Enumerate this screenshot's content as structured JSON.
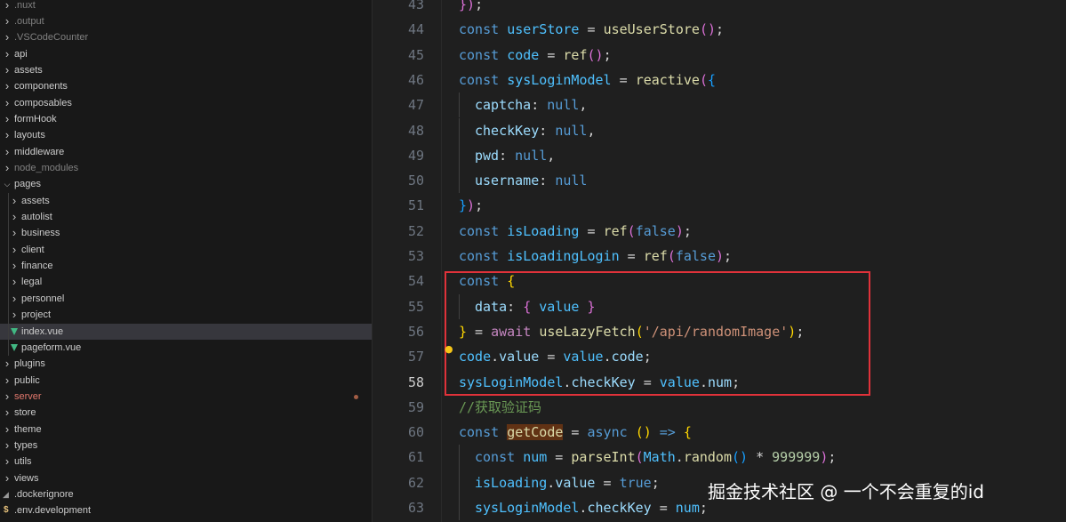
{
  "explorer": {
    "items": [
      {
        "label": ".nuxt",
        "depth": 0,
        "kind": "folder",
        "expanded": false,
        "dim": true
      },
      {
        "label": ".output",
        "depth": 0,
        "kind": "folder",
        "expanded": false,
        "dim": true
      },
      {
        "label": ".VSCodeCounter",
        "depth": 0,
        "kind": "folder",
        "expanded": false,
        "dim": true
      },
      {
        "label": "api",
        "depth": 0,
        "kind": "folder",
        "expanded": false
      },
      {
        "label": "assets",
        "depth": 0,
        "kind": "folder",
        "expanded": false
      },
      {
        "label": "components",
        "depth": 0,
        "kind": "folder",
        "expanded": false
      },
      {
        "label": "composables",
        "depth": 0,
        "kind": "folder",
        "expanded": false
      },
      {
        "label": "formHook",
        "depth": 0,
        "kind": "folder",
        "expanded": false
      },
      {
        "label": "layouts",
        "depth": 0,
        "kind": "folder",
        "expanded": false
      },
      {
        "label": "middleware",
        "depth": 0,
        "kind": "folder",
        "expanded": false
      },
      {
        "label": "node_modules",
        "depth": 0,
        "kind": "folder",
        "expanded": false,
        "dim": true
      },
      {
        "label": "pages",
        "depth": 0,
        "kind": "folder",
        "expanded": true
      },
      {
        "label": "assets",
        "depth": 1,
        "kind": "folder",
        "expanded": false
      },
      {
        "label": "autolist",
        "depth": 1,
        "kind": "folder",
        "expanded": false
      },
      {
        "label": "business",
        "depth": 1,
        "kind": "folder",
        "expanded": false
      },
      {
        "label": "client",
        "depth": 1,
        "kind": "folder",
        "expanded": false
      },
      {
        "label": "finance",
        "depth": 1,
        "kind": "folder",
        "expanded": false
      },
      {
        "label": "legal",
        "depth": 1,
        "kind": "folder",
        "expanded": false
      },
      {
        "label": "personnel",
        "depth": 1,
        "kind": "folder",
        "expanded": false
      },
      {
        "label": "project",
        "depth": 1,
        "kind": "folder",
        "expanded": false
      },
      {
        "label": "index.vue",
        "depth": 1,
        "kind": "vue",
        "selected": true
      },
      {
        "label": "pageform.vue",
        "depth": 1,
        "kind": "vue"
      },
      {
        "label": "plugins",
        "depth": 0,
        "kind": "folder",
        "expanded": false
      },
      {
        "label": "public",
        "depth": 0,
        "kind": "folder",
        "expanded": false
      },
      {
        "label": "server",
        "depth": 0,
        "kind": "folder",
        "expanded": false,
        "modified": true
      },
      {
        "label": "store",
        "depth": 0,
        "kind": "folder",
        "expanded": false
      },
      {
        "label": "theme",
        "depth": 0,
        "kind": "folder",
        "expanded": false
      },
      {
        "label": "types",
        "depth": 0,
        "kind": "folder",
        "expanded": false
      },
      {
        "label": "utils",
        "depth": 0,
        "kind": "folder",
        "expanded": false
      },
      {
        "label": "views",
        "depth": 0,
        "kind": "folder",
        "expanded": false
      },
      {
        "label": ".dockerignore",
        "depth": 0,
        "kind": "docker"
      },
      {
        "label": ".env.development",
        "depth": 0,
        "kind": "env"
      }
    ]
  },
  "editor": {
    "active_line": 58,
    "lines": [
      {
        "n": 43,
        "indent": 0,
        "tokens": [
          [
            "b2",
            "})"
          ],
          [
            "op",
            ";"
          ]
        ]
      },
      {
        "n": 44,
        "indent": 0,
        "tokens": [
          [
            "kw",
            "const"
          ],
          [
            "op",
            " "
          ],
          [
            "var",
            "userStore"
          ],
          [
            "op",
            " = "
          ],
          [
            "fn",
            "useUserStore"
          ],
          [
            "b2",
            "()"
          ],
          [
            "op",
            ";"
          ]
        ]
      },
      {
        "n": 45,
        "indent": 0,
        "tokens": [
          [
            "kw",
            "const"
          ],
          [
            "op",
            " "
          ],
          [
            "var",
            "code"
          ],
          [
            "op",
            " = "
          ],
          [
            "fn",
            "ref"
          ],
          [
            "b2",
            "()"
          ],
          [
            "op",
            ";"
          ]
        ]
      },
      {
        "n": 46,
        "indent": 0,
        "tokens": [
          [
            "kw",
            "const"
          ],
          [
            "op",
            " "
          ],
          [
            "var",
            "sysLoginModel"
          ],
          [
            "op",
            " = "
          ],
          [
            "fn",
            "reactive"
          ],
          [
            "b2",
            "("
          ],
          [
            "b3",
            "{"
          ]
        ]
      },
      {
        "n": 47,
        "indent": 1,
        "tokens": [
          [
            "prop",
            "captcha"
          ],
          [
            "op",
            ": "
          ],
          [
            "kw",
            "null"
          ],
          [
            "op",
            ","
          ]
        ]
      },
      {
        "n": 48,
        "indent": 1,
        "tokens": [
          [
            "prop",
            "checkKey"
          ],
          [
            "op",
            ": "
          ],
          [
            "kw",
            "null"
          ],
          [
            "op",
            ","
          ]
        ]
      },
      {
        "n": 49,
        "indent": 1,
        "tokens": [
          [
            "prop",
            "pwd"
          ],
          [
            "op",
            ": "
          ],
          [
            "kw",
            "null"
          ],
          [
            "op",
            ","
          ]
        ]
      },
      {
        "n": 50,
        "indent": 1,
        "tokens": [
          [
            "prop",
            "username"
          ],
          [
            "op",
            ": "
          ],
          [
            "kw",
            "null"
          ]
        ]
      },
      {
        "n": 51,
        "indent": 0,
        "tokens": [
          [
            "b3",
            "}"
          ],
          [
            "b2",
            ")"
          ],
          [
            "op",
            ";"
          ]
        ]
      },
      {
        "n": 52,
        "indent": 0,
        "tokens": [
          [
            "kw",
            "const"
          ],
          [
            "op",
            " "
          ],
          [
            "var",
            "isLoading"
          ],
          [
            "op",
            " = "
          ],
          [
            "fn",
            "ref"
          ],
          [
            "b2",
            "("
          ],
          [
            "kw",
            "false"
          ],
          [
            "b2",
            ")"
          ],
          [
            "op",
            ";"
          ]
        ]
      },
      {
        "n": 53,
        "indent": 0,
        "tokens": [
          [
            "kw",
            "const"
          ],
          [
            "op",
            " "
          ],
          [
            "var",
            "isLoadingLogin"
          ],
          [
            "op",
            " = "
          ],
          [
            "fn",
            "ref"
          ],
          [
            "b2",
            "("
          ],
          [
            "kw",
            "false"
          ],
          [
            "b2",
            ")"
          ],
          [
            "op",
            ";"
          ]
        ]
      },
      {
        "n": 54,
        "indent": 0,
        "tokens": [
          [
            "kw",
            "const"
          ],
          [
            "op",
            " "
          ],
          [
            "b1",
            "{"
          ]
        ]
      },
      {
        "n": 55,
        "indent": 1,
        "tokens": [
          [
            "prop",
            "data"
          ],
          [
            "op",
            ": "
          ],
          [
            "b2",
            "{"
          ],
          [
            "op",
            " "
          ],
          [
            "var",
            "value"
          ],
          [
            "op",
            " "
          ],
          [
            "b2",
            "}"
          ]
        ]
      },
      {
        "n": 56,
        "indent": 0,
        "tokens": [
          [
            "b1",
            "}"
          ],
          [
            "op",
            " = "
          ],
          [
            "kw2",
            "await"
          ],
          [
            "op",
            " "
          ],
          [
            "fn",
            "useLazyFetch"
          ],
          [
            "b1",
            "("
          ],
          [
            "str",
            "'/api/randomImage'"
          ],
          [
            "b1",
            ")"
          ],
          [
            "op",
            ";"
          ]
        ]
      },
      {
        "n": 57,
        "indent": 0,
        "tokens": [
          [
            "var",
            "code"
          ],
          [
            "op",
            "."
          ],
          [
            "prop",
            "value"
          ],
          [
            "op",
            " = "
          ],
          [
            "var",
            "value"
          ],
          [
            "op",
            "."
          ],
          [
            "prop",
            "code"
          ],
          [
            "op",
            ";"
          ]
        ]
      },
      {
        "n": 58,
        "indent": 0,
        "tokens": [
          [
            "var",
            "sysLoginModel"
          ],
          [
            "op",
            "."
          ],
          [
            "prop",
            "checkKey"
          ],
          [
            "op",
            " = "
          ],
          [
            "var",
            "value"
          ],
          [
            "op",
            "."
          ],
          [
            "prop",
            "num"
          ],
          [
            "op",
            ";"
          ]
        ]
      },
      {
        "n": 59,
        "indent": 0,
        "tokens": [
          [
            "cmt",
            "//获取验证码"
          ]
        ]
      },
      {
        "n": 60,
        "indent": 0,
        "tokens": [
          [
            "kw",
            "const"
          ],
          [
            "op",
            " "
          ],
          [
            "hl",
            "getCode"
          ],
          [
            "op",
            " = "
          ],
          [
            "kw",
            "async"
          ],
          [
            "op",
            " "
          ],
          [
            "b1",
            "()"
          ],
          [
            "op",
            " "
          ],
          [
            "kw",
            "=>"
          ],
          [
            "op",
            " "
          ],
          [
            "b1",
            "{"
          ]
        ]
      },
      {
        "n": 61,
        "indent": 1,
        "tokens": [
          [
            "kw",
            "const"
          ],
          [
            "op",
            " "
          ],
          [
            "var",
            "num"
          ],
          [
            "op",
            " = "
          ],
          [
            "fn",
            "parseInt"
          ],
          [
            "b2",
            "("
          ],
          [
            "var",
            "Math"
          ],
          [
            "op",
            "."
          ],
          [
            "fn",
            "random"
          ],
          [
            "b3",
            "()"
          ],
          [
            "op",
            " * "
          ],
          [
            "num",
            "999999"
          ],
          [
            "b2",
            ")"
          ],
          [
            "op",
            ";"
          ]
        ]
      },
      {
        "n": 62,
        "indent": 1,
        "tokens": [
          [
            "var",
            "isLoading"
          ],
          [
            "op",
            "."
          ],
          [
            "prop",
            "value"
          ],
          [
            "op",
            " = "
          ],
          [
            "kw",
            "true"
          ],
          [
            "op",
            ";"
          ]
        ]
      },
      {
        "n": 63,
        "indent": 1,
        "tokens": [
          [
            "var",
            "sysLoginModel"
          ],
          [
            "op",
            "."
          ],
          [
            "prop",
            "checkKey"
          ],
          [
            "op",
            " = "
          ],
          [
            "var",
            "num"
          ],
          [
            "op",
            ";"
          ]
        ]
      }
    ]
  },
  "watermark": "掘金技术社区 @ 一个不会重复的id",
  "colors": {
    "highlight_box": "#e0323a",
    "vue_icon": "#41b883",
    "modified_text": "#e2786d"
  }
}
